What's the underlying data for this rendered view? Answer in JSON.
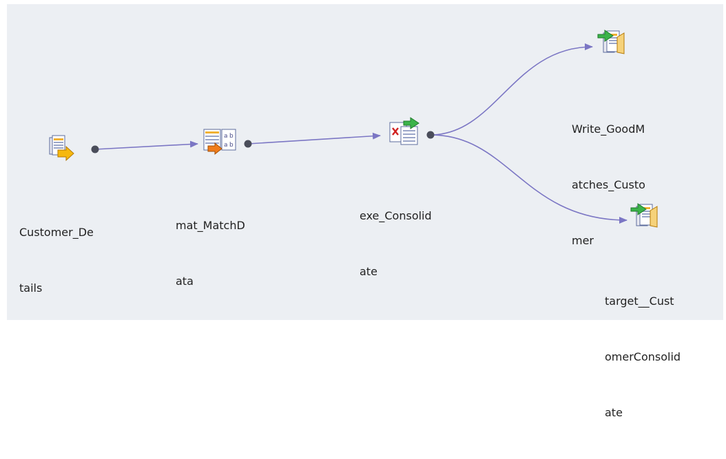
{
  "colors": {
    "background": "#eceff3",
    "link": "#7b76c4",
    "port": "#4a4d5a",
    "label": "#222222"
  },
  "nodes": [
    {
      "id": "customer-details",
      "icon": "source-icon",
      "label_lines": [
        "Customer_De",
        "tails"
      ]
    },
    {
      "id": "mat-matchdata",
      "icon": "match-icon",
      "label_lines": [
        "mat_MatchD",
        "ata"
      ]
    },
    {
      "id": "exe-consolidate",
      "icon": "consolidate-icon",
      "label_lines": [
        "exe_Consolid",
        "ate"
      ]
    },
    {
      "id": "write-goodmatches-customer",
      "icon": "target-icon",
      "label_lines": [
        "Write_GoodM",
        "atches_Custo",
        "mer"
      ]
    },
    {
      "id": "target-customerconsolidate",
      "icon": "target-icon",
      "label_lines": [
        "target__Cust",
        "omerConsolid",
        "ate"
      ]
    }
  ],
  "links": [
    {
      "from": "customer-details",
      "to": "mat-matchdata"
    },
    {
      "from": "mat-matchdata",
      "to": "exe-consolidate"
    },
    {
      "from": "exe-consolidate",
      "to": "write-goodmatches-customer"
    },
    {
      "from": "exe-consolidate",
      "to": "target-customerconsolidate"
    }
  ]
}
